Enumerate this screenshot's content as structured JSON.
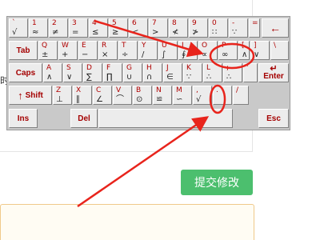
{
  "side_text": "时",
  "keyboard": {
    "row1": [
      {
        "top": "`",
        "bottom": "√"
      },
      {
        "top": "1",
        "bottom": "≈"
      },
      {
        "top": "2",
        "bottom": "≠"
      },
      {
        "top": "3",
        "bottom": "="
      },
      {
        "top": "4",
        "bottom": "≤"
      },
      {
        "top": "5",
        "bottom": "≥"
      },
      {
        "top": "6",
        "bottom": "<"
      },
      {
        "top": "7",
        "bottom": ">"
      },
      {
        "top": "8",
        "bottom": "≮"
      },
      {
        "top": "9",
        "bottom": "≯"
      },
      {
        "top": "0",
        "bottom": "∷"
      },
      {
        "top": "-",
        "bottom": "∵"
      },
      {
        "top": "=",
        "bottom": ""
      }
    ],
    "backspace": "←",
    "tab": "Tab",
    "row2": [
      {
        "top": "Q",
        "bottom": "±"
      },
      {
        "top": "W",
        "bottom": "+"
      },
      {
        "top": "E",
        "bottom": "−"
      },
      {
        "top": "R",
        "bottom": "×"
      },
      {
        "top": "T",
        "bottom": "÷"
      },
      {
        "top": "Y",
        "bottom": "/"
      },
      {
        "top": "U",
        "bottom": "∫"
      },
      {
        "top": "I",
        "bottom": "∮"
      },
      {
        "top": "O",
        "bottom": "∝"
      },
      {
        "top": "P",
        "bottom": "∞"
      },
      {
        "top": "[",
        "bottom": "∧"
      },
      {
        "top": "]",
        "bottom": "∨"
      },
      {
        "top": "\\",
        "bottom": ""
      }
    ],
    "caps": "Caps",
    "row3": [
      {
        "top": "A",
        "bottom": "∧"
      },
      {
        "top": "S",
        "bottom": "∨"
      },
      {
        "top": "D",
        "bottom": "∑"
      },
      {
        "top": "F",
        "bottom": "∏"
      },
      {
        "top": "G",
        "bottom": "∪"
      },
      {
        "top": "H",
        "bottom": "∩"
      },
      {
        "top": "J",
        "bottom": "∈"
      },
      {
        "top": "K",
        "bottom": "∵"
      },
      {
        "top": "L",
        "bottom": "∴"
      },
      {
        "top": ";",
        "bottom": "∴"
      },
      {
        "top": "'",
        "bottom": ""
      }
    ],
    "enter_arrow": "↵",
    "enter": "Enter",
    "shift_arrow": "↑",
    "shift": "Shift",
    "row4": [
      {
        "top": "Z",
        "bottom": "⊥"
      },
      {
        "top": "X",
        "bottom": "∥"
      },
      {
        "top": "C",
        "bottom": "∠"
      },
      {
        "top": "V",
        "bottom": "⌒"
      },
      {
        "top": "B",
        "bottom": "⊙"
      },
      {
        "top": "N",
        "bottom": "≌"
      },
      {
        "top": "M",
        "bottom": "∽"
      },
      {
        "top": ",",
        "bottom": "√"
      },
      {
        "top": ".",
        "bottom": ""
      },
      {
        "top": "/",
        "bottom": ""
      }
    ],
    "ins": "Ins",
    "del": "Del",
    "esc": "Esc"
  },
  "submit_button": "提交修改",
  "annotation_color": "#e8241c"
}
